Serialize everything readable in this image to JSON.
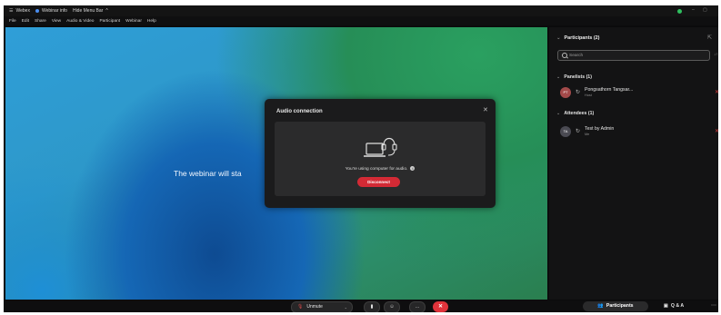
{
  "titlebar": {
    "app_name": "Webex",
    "webinar_info": "Webinar info",
    "hide_menu_bar": "Hide Menu Bar",
    "hide_menu_chevron": "^"
  },
  "menubar": [
    "File",
    "Edit",
    "Share",
    "View",
    "Audio & Video",
    "Participant",
    "Webinar",
    "Help"
  ],
  "stage": {
    "message": "The webinar will sta"
  },
  "audio_dialog": {
    "title": "Audio connection",
    "close_icon": "close-icon",
    "status_text": "You're using computer for audio.",
    "disconnect_label": "Disconnect"
  },
  "panel": {
    "title": "Participants (2)",
    "search_placeholder": "Search",
    "search_extra": "↓↑",
    "panelists_header": "Panelists (1)",
    "attendees_header": "Attendees (1)",
    "panelists": [
      {
        "initials": "PT",
        "name": "Pongsathorn Tangsar...",
        "role": "Host"
      }
    ],
    "attendees": [
      {
        "initials": "TA",
        "name": "Test by Admin",
        "role": "Me"
      }
    ]
  },
  "bottombar": {
    "unmute_label": "Unmute",
    "participants_label": "Participants",
    "qa_label": "Q & A"
  },
  "colors": {
    "accent_red": "#d32a35",
    "panel_bg": "#131314",
    "status_green": "#2fbf5f"
  }
}
